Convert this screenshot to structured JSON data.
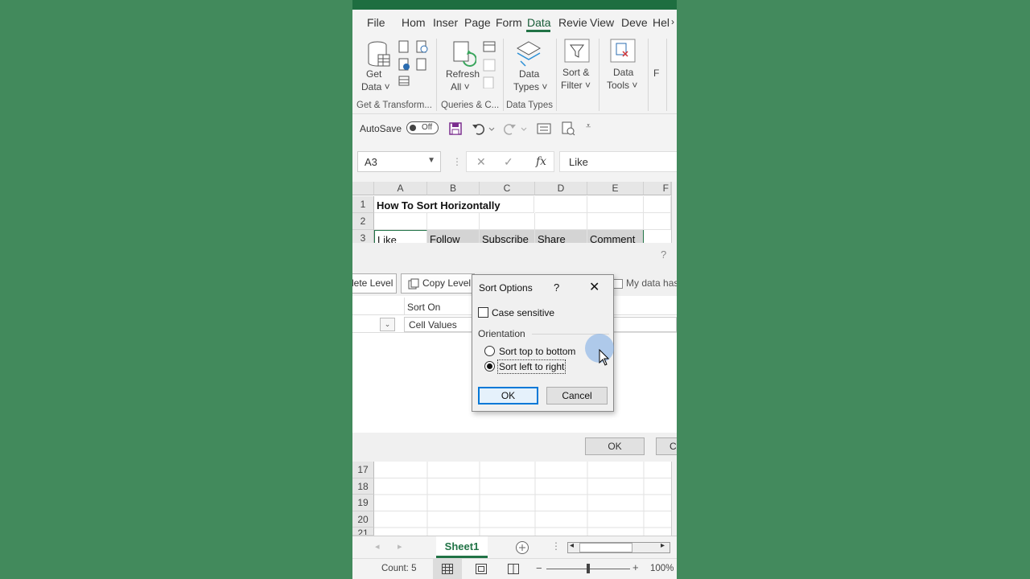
{
  "ribbon": {
    "tabs": [
      "File",
      "Hom",
      "Inser",
      "Page",
      "Form",
      "Data",
      "Revie",
      "View",
      "Deve",
      "Hel"
    ],
    "active_tab": "Data",
    "buttons": {
      "get_data": [
        "Get",
        "Data ˅"
      ],
      "refresh_all": [
        "Refresh",
        "All ˅"
      ],
      "data_types": [
        "Data",
        "Types ˅"
      ],
      "sort_filter": [
        "Sort &",
        "Filter ˅"
      ],
      "data_tools": [
        "Data",
        "Tools ˅"
      ],
      "forecast_fragment": "F"
    },
    "groups": [
      "Get & Transform...",
      "Queries & C...",
      "Data Types"
    ]
  },
  "qat": {
    "autosave_label": "AutoSave",
    "toggle_state": "Off"
  },
  "formula_bar": {
    "name_box": "A3",
    "formula": "Like"
  },
  "grid": {
    "columns": [
      "A",
      "B",
      "C",
      "D",
      "E",
      "F"
    ],
    "row1": {
      "num": "1",
      "A": "How To Sort Horizontally"
    },
    "row2": {
      "num": "2"
    },
    "row3": {
      "num": "3",
      "cells": [
        "Like",
        "Follow",
        "Subscribe",
        "Share",
        "Comment"
      ]
    },
    "lower_rows": [
      "17",
      "18",
      "19",
      "20",
      "21"
    ]
  },
  "sort_dialog": {
    "help": "?",
    "delete_level": "lete Level",
    "copy_level": "Copy Level",
    "my_data_has": "My data has",
    "column_sort_on": "Sort On",
    "sort_on_value": "Cell Values",
    "ok": "OK",
    "cancel_fragment": "C"
  },
  "sort_options": {
    "title": "Sort Options",
    "help": "?",
    "close": "✕",
    "case_sensitive": "Case sensitive",
    "orientation_label": "Orientation",
    "top_to_bottom": "Sort top to bottom",
    "left_to_right": "Sort left to right",
    "selected": "left_to_right",
    "ok": "OK",
    "cancel": "Cancel"
  },
  "sheets": {
    "active": "Sheet1"
  },
  "status": {
    "count": "Count: 5",
    "zoom": "100%"
  },
  "colors": {
    "excel_green": "#217346",
    "background_green": "#438a5e",
    "focus_blue": "#0078d7"
  }
}
